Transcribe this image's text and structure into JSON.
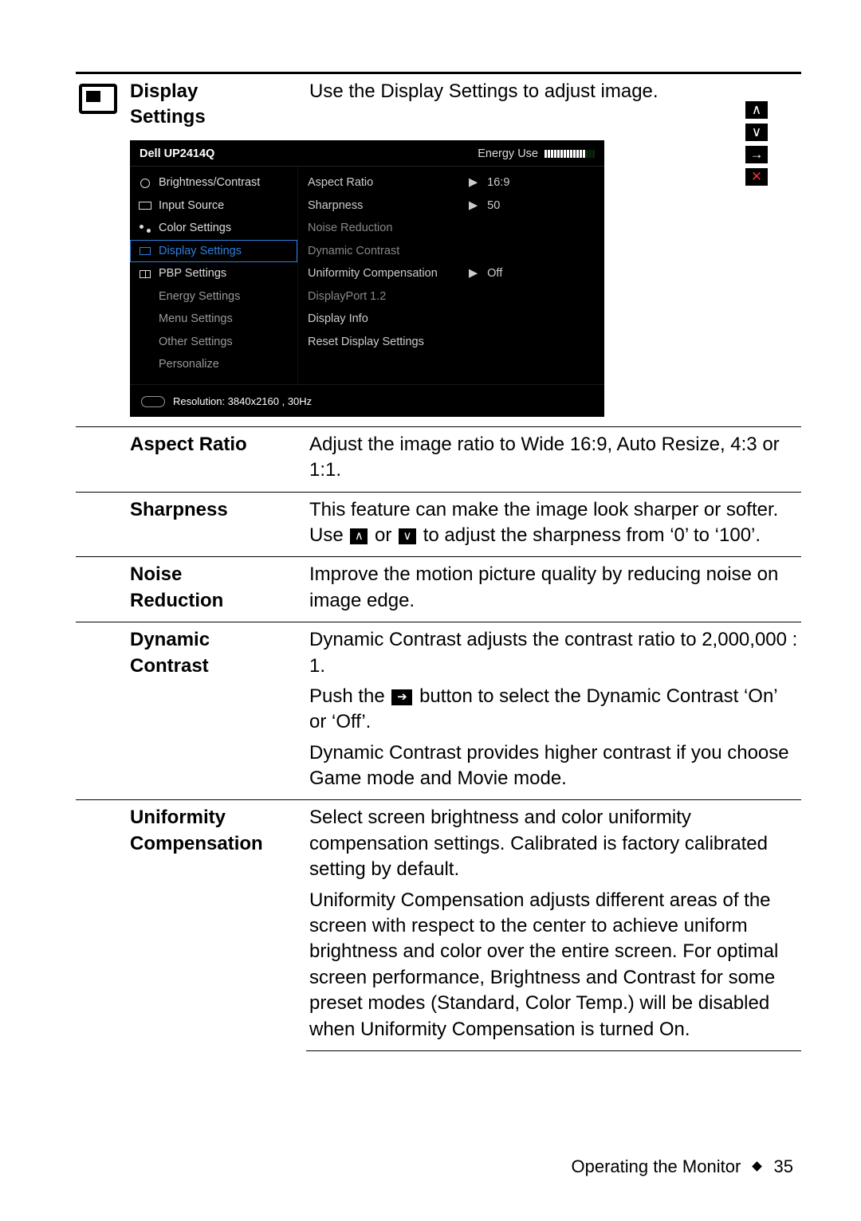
{
  "page": {
    "section_title": "Operating the Monitor",
    "page_number": "35"
  },
  "rows": {
    "display_settings": {
      "label_l1": "Display",
      "label_l2": "Settings",
      "desc": "Use the Display Settings to adjust image."
    },
    "aspect_ratio": {
      "label": "Aspect Ratio",
      "desc": "Adjust the image ratio to Wide 16:9, Auto Resize, 4:3 or 1:1."
    },
    "sharpness": {
      "label": "Sharpness",
      "seg1": "This feature can make the image look sharper or softer. Use ",
      "seg2": " or ",
      "seg3": " to adjust the sharpness from ‘0’ to ‘100’."
    },
    "noise": {
      "label_l1": "Noise",
      "label_l2": "Reduction",
      "desc": "Improve the motion picture quality by reducing noise on image edge."
    },
    "dynamic_contrast": {
      "label_l1": "Dynamic",
      "label_l2": "Contrast",
      "p1": "Dynamic Contrast adjusts the contrast ratio to 2,000,000 : 1.",
      "p2a": "Push the ",
      "p2b": " button to select the Dynamic Contrast ‘On’ or ‘Off’.",
      "p3": "Dynamic Contrast provides higher contrast if you choose Game mode and Movie mode."
    },
    "uniformity": {
      "label_l1": "Uniformity",
      "label_l2": "Compensation",
      "p1": "Select screen brightness and color uniformity compensation settings. Calibrated is factory calibrated setting by default.",
      "p2": "Uniformity Compensation adjusts different areas of the screen with respect to the center to achieve uniform brightness and color over the entire screen. For optimal screen performance, Brightness and Contrast for some preset modes (Standard, Color Temp.) will be disabled when Uniformity Compensation is turned On."
    }
  },
  "osd": {
    "brand": "Dell UP2414Q",
    "energy_label": "Energy Use",
    "nav": {
      "brightness": "Brightness/Contrast",
      "input": "Input Source",
      "color": "Color Settings",
      "display": "Display Settings",
      "pbp": "PBP Settings",
      "energy": "Energy Settings",
      "menu": "Menu Settings",
      "other": "Other Settings",
      "personalize": "Personalize"
    },
    "opts": {
      "aspect_ratio_k": "Aspect Ratio",
      "aspect_ratio_v": "16:9",
      "sharpness_k": "Sharpness",
      "sharpness_v": "50",
      "noise_k": "Noise Reduction",
      "dyncon_k": "Dynamic Contrast",
      "unif_k": "Uniformity Compensation",
      "unif_v": "Off",
      "dp12_k": "DisplayPort 1.2",
      "info_k": "Display Info",
      "reset_k": "Reset Display Settings"
    },
    "footer_res": "Resolution: 3840x2160 , 30Hz"
  }
}
